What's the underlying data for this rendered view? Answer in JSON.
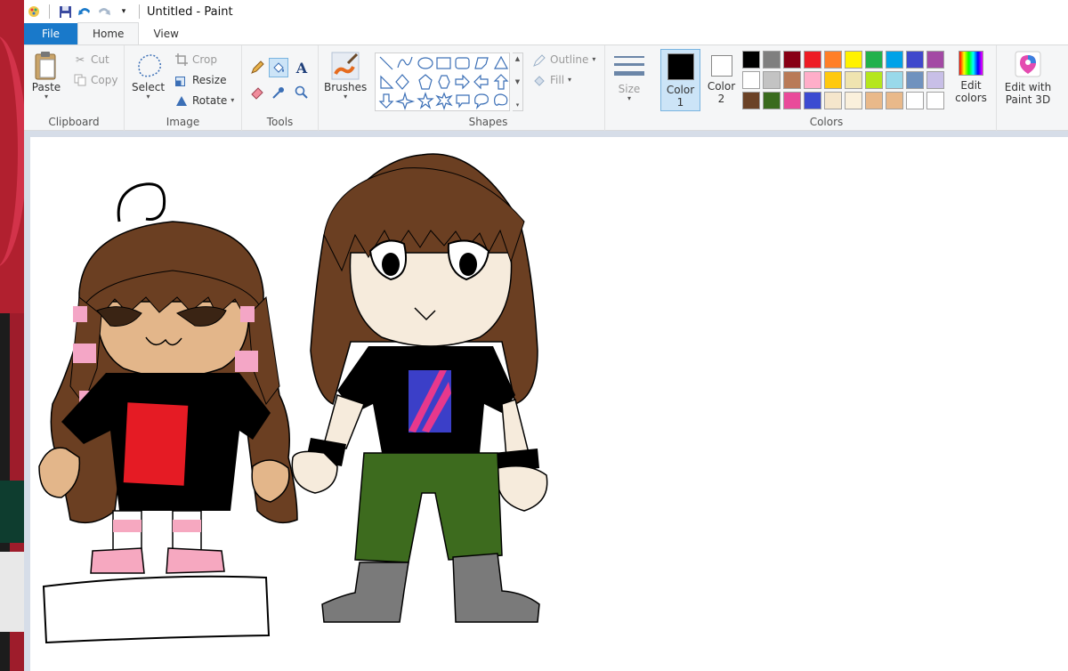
{
  "window": {
    "title": "Untitled - Paint"
  },
  "quick_access": {
    "icons": [
      "paint-app-icon",
      "save-icon",
      "undo-icon",
      "redo-icon",
      "customize-dropdown-icon"
    ]
  },
  "tabs": [
    {
      "label": "File"
    },
    {
      "label": "Home"
    },
    {
      "label": "View"
    }
  ],
  "ribbon": {
    "clipboard": {
      "label": "Clipboard",
      "paste": "Paste",
      "cut": "Cut",
      "copy": "Copy"
    },
    "image": {
      "label": "Image",
      "select": "Select",
      "crop": "Crop",
      "resize": "Resize",
      "rotate": "Rotate"
    },
    "tools": {
      "label": "Tools"
    },
    "brushes": {
      "label": "Brushes"
    },
    "shapes": {
      "label": "Shapes",
      "outline": "Outline",
      "fill": "Fill"
    },
    "size": {
      "label": "Size"
    },
    "colors": {
      "label": "Colors",
      "color1_line1": "Color",
      "color1_line2": "1",
      "color2_line1": "Color",
      "color2_line2": "2",
      "edit_line1": "Edit",
      "edit_line2": "colors",
      "paint3d_line1": "Edit with",
      "paint3d_line2": "Paint 3D",
      "color1_value": "#000000",
      "color2_value": "#ffffff",
      "palette_row1": [
        "#000000",
        "#7f7f7f",
        "#880015",
        "#ed1c24",
        "#ff7f27",
        "#fff200",
        "#22b14c",
        "#00a2e8",
        "#3f48cc",
        "#a349a4"
      ],
      "palette_row2": [
        "#ffffff",
        "#c3c3c3",
        "#b97a57",
        "#ffaec9",
        "#ffc90e",
        "#efe4b0",
        "#b5e61d",
        "#99d9ea",
        "#7092be",
        "#c8bfe7"
      ],
      "palette_row3": [
        "#6b4226",
        "#3a6b1e",
        "#e94a9a",
        "#3b4bd1",
        "#f5e6cc",
        "#faf0dc",
        "#e9b98a",
        "#e9b98a",
        "#ffffff",
        "#ffffff"
      ]
    }
  },
  "canvas": {
    "palette": {
      "hair": "#6b3f22",
      "skin_girl": "#e3b68a",
      "skin_boy": "#f6ebdc",
      "blush": "#f4a6c6",
      "shirt": "#000000",
      "girl_panel": "#e51b24",
      "pants": "#3d6b1e",
      "boots": "#7a7a7a",
      "shoes": "#f6a8c0",
      "headband": "#f3e4a8",
      "patch_blue": "#3b3fc8",
      "patch_pink": "#e7388c"
    }
  }
}
